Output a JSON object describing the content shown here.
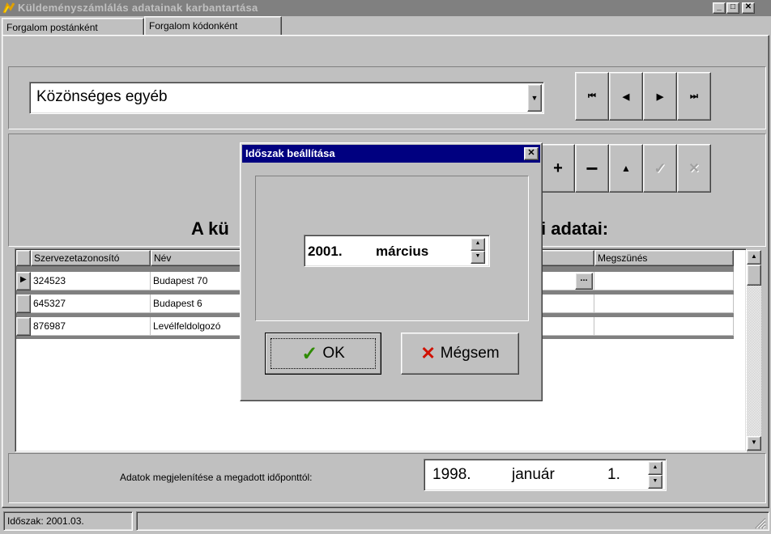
{
  "window": {
    "title": "Küldeményszámlálás adatainak karbantartása",
    "min": "_",
    "max": "□",
    "close": "✕"
  },
  "tabs": [
    {
      "label": "Forgalom postánként"
    },
    {
      "label": "Forgalom kódonként"
    }
  ],
  "combo": {
    "value": "Közönséges egyéb"
  },
  "nav": {
    "first": "⏮",
    "prev": "◀",
    "next": "▶",
    "last": "⏭"
  },
  "actions": {
    "add": "+",
    "remove": "−",
    "up": "▲",
    "confirm": "✓",
    "cancel": "✕"
  },
  "heading_left": "A kü",
  "heading_right": "i adatai:",
  "grid": {
    "columns": [
      "Szervezetazonosító",
      "Név",
      "Megszünés"
    ],
    "rows": [
      {
        "id": "324523",
        "name": "Budapest 70"
      },
      {
        "id": "645327",
        "name": "Budapest 6"
      },
      {
        "id": "876987",
        "name": "Levélfeldolgozó"
      }
    ],
    "ellipsis": "..."
  },
  "footer": {
    "label": "Adatok megjelenítése a megadott időponttól:",
    "year": "1998.",
    "month": "január",
    "day": "1."
  },
  "status": {
    "text": "Időszak: 2001.03."
  },
  "dialog": {
    "title": "Időszak beállítása",
    "close": "✕",
    "year": "2001.",
    "month": "március",
    "ok": "OK",
    "cancel": "Mégsem"
  },
  "colors": {
    "title_active": "#000080",
    "title_inactive": "#808080",
    "face": "#c0c0c0",
    "ok_check": "#2e8b00",
    "cancel_x": "#d01000"
  }
}
